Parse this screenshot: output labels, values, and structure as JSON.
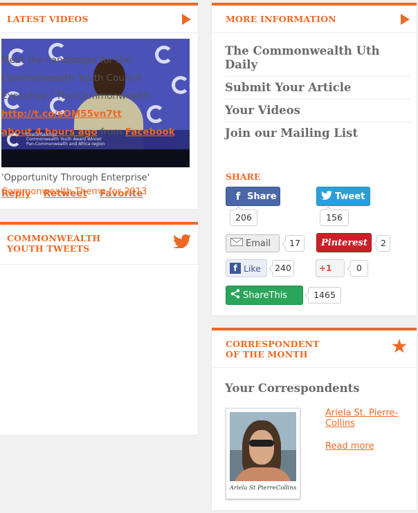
{
  "latest_videos": {
    "title": "LATEST VIDEOS",
    "video": {
      "overlay_name": "Evans Rabingo",
      "overlay_line1": "Commonwealth Youth Award Winner",
      "overlay_line2": "Pan-Commonwealth and Africa region"
    },
    "caption_line1": "'Opportunity Through Enterprise'",
    "caption_line2": "Commonwealth Theme for 2013"
  },
  "youth_tweets": {
    "title_line1": "COMMONWEALTH",
    "title_line2": "YOUTH TWEETS",
    "tweet_line1": "Meet the candidates for the",
    "tweet_line2": "Commonwealth Youth Council",
    "tweet_line3": "Executive | The Commonwealth",
    "tweet_link": "http://t.co/sOM55vn7tt",
    "tweet_time": "about 4 hours ago",
    "tweet_from": "from",
    "tweet_source": "Facebook",
    "actions": {
      "reply": "Reply",
      "retweet": "Retweet",
      "favorite": "Favorite"
    }
  },
  "more_information": {
    "title": "MORE INFORMATION",
    "links": [
      "The Commonwealth Uth Daily",
      "Submit Your Article",
      "Your Videos",
      "Join our Mailing List"
    ],
    "share_title": "SHARE",
    "share": {
      "facebook": {
        "label": "Share",
        "count": "206"
      },
      "twitter": {
        "label": "Tweet",
        "count": "156"
      },
      "email": {
        "label": "Email",
        "count": "17"
      },
      "pinterest": {
        "label": "Pinterest",
        "count": "2"
      },
      "like": {
        "label": "Like",
        "count": "240"
      },
      "googleplus": {
        "label": "+1",
        "count": "0"
      },
      "sharethis": {
        "label": "ShareThis",
        "count": "1465"
      }
    }
  },
  "correspondent": {
    "title_line1": "CORRESPONDENT",
    "title_line2": "OF THE MONTH",
    "subtitle": "Your Correspondents",
    "photo_caption": "Ariela St PierreCollins",
    "name": "Ariela St. Pierre-Collins",
    "read_more": "Read more"
  },
  "colors": {
    "accent": "#ec6a26",
    "facebook": "#4a67a8",
    "twitter": "#2c9fd8",
    "pinterest": "#cb2027",
    "sharethis": "#2aa55a"
  }
}
